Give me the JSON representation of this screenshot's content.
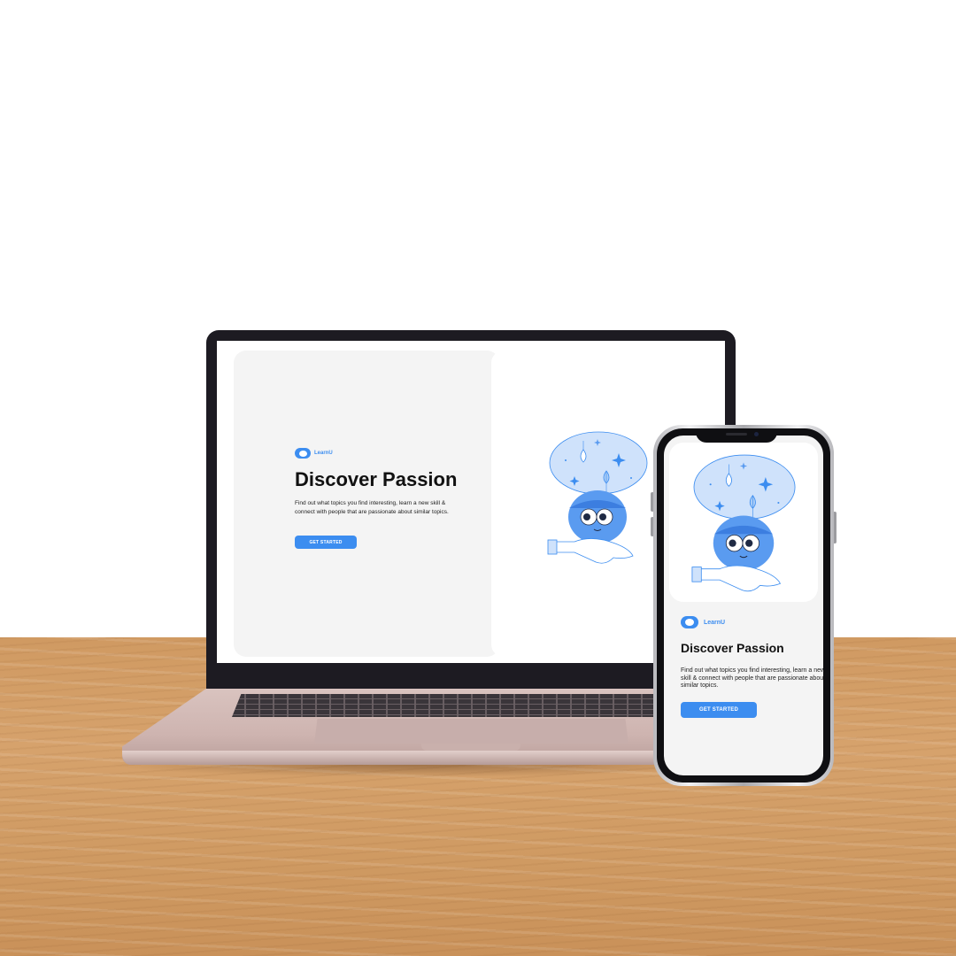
{
  "colors": {
    "accent": "#3c8df0",
    "card_bg": "#f4f4f4",
    "text_dark": "#111111"
  },
  "app": {
    "brand_name": "LearnU",
    "brand_icon": "cloud-logo-icon",
    "headline": "Discover Passion",
    "description": "Find out what topics you find interesting, learn a new skill & connect with people that are passionate about similar topics.",
    "cta_label": "GET STARTED",
    "illustration": "mascot-lightbulb-hand-icon"
  },
  "laptop": {
    "brand_name": "LearnU",
    "headline": "Discover Passion",
    "description": "Find out what topics you find interesting, learn a new skill & connect with people that are passionate about similar topics.",
    "cta_label": "GET STARTED"
  },
  "phone": {
    "brand_name": "LearnU",
    "headline": "Discover Passion",
    "description": "Find out what topics you find interesting, learn a new skill & connect with people that are passionate about similar topics.",
    "cta_label": "GET STARTED"
  }
}
